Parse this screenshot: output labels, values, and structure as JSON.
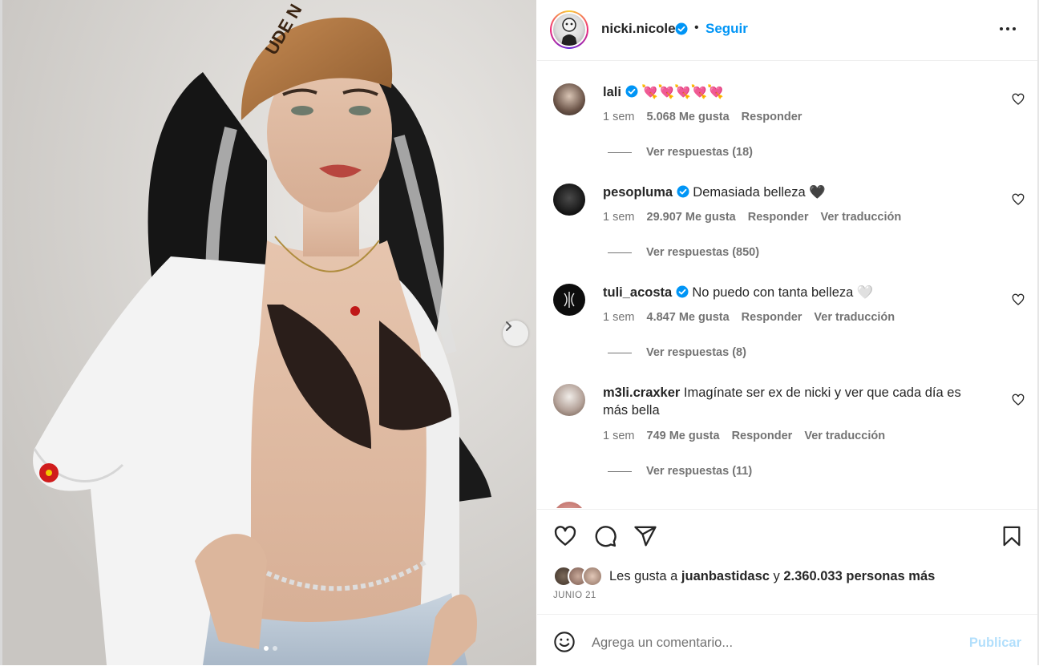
{
  "post": {
    "author": "nicki.nicole",
    "follow_label": "Seguir",
    "separator": "•",
    "carousel": {
      "total_slides": 2,
      "current_slide": 1
    }
  },
  "comments": [
    {
      "username": "lali",
      "verified": true,
      "text": "💘💘💘💘💘",
      "time": "1 sem",
      "likes": "5.068 Me gusta",
      "reply_label": "Responder",
      "translate_label": "",
      "replies": "Ver respuestas (18)"
    },
    {
      "username": "pesopluma",
      "verified": true,
      "text": "Demasiada belleza 🖤",
      "time": "1 sem",
      "likes": "29.907 Me gusta",
      "reply_label": "Responder",
      "translate_label": "Ver traducción",
      "replies": "Ver respuestas (850)"
    },
    {
      "username": "tuli_acosta",
      "verified": true,
      "text": "No puedo con tanta belleza 🤍",
      "time": "1 sem",
      "likes": "4.847 Me gusta",
      "reply_label": "Responder",
      "translate_label": "Ver traducción",
      "replies": "Ver respuestas (8)"
    },
    {
      "username": "m3li.craxker",
      "verified": false,
      "text": "Imagínate ser ex de nicki y ver que cada día es más bella",
      "time": "1 sem",
      "likes": "749 Me gusta",
      "reply_label": "Responder",
      "translate_label": "Ver traducción",
      "replies": "Ver respuestas (11)"
    }
  ],
  "likes_summary": {
    "prefix": "Les gusta a ",
    "first_user": "juanbastidasc",
    "middle": " y ",
    "others": "2.360.033 personas más"
  },
  "date": "JUNIO 21",
  "comment_box": {
    "placeholder": "Agrega un comentario...",
    "publish_label": "Publicar"
  },
  "colors": {
    "accent": "#0095f6",
    "verified": "#0095f6",
    "publish_disabled": "#b2dffc",
    "muted_text": "#737373"
  },
  "icons": [
    "like-icon",
    "comment-icon",
    "share-icon",
    "save-icon",
    "emoji-icon",
    "more-options-icon",
    "chevron-right-icon",
    "verified-badge-icon"
  ]
}
